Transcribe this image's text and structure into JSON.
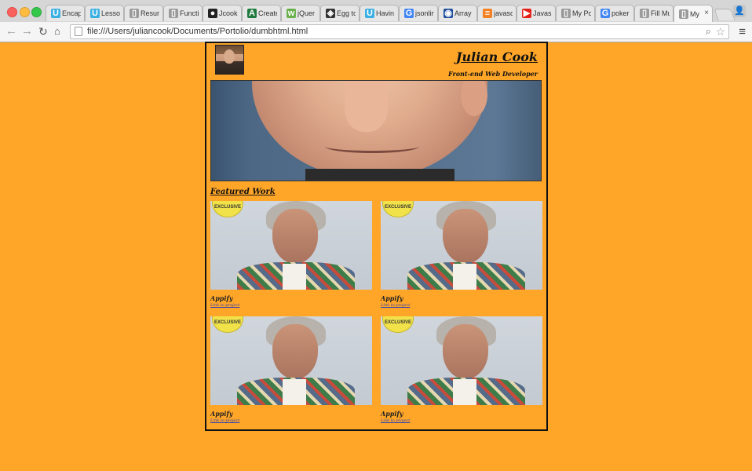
{
  "browser": {
    "tabs": [
      {
        "title": "Encap",
        "icon": "udacity-icon",
        "color": "#3ab0e2",
        "glyph": "U"
      },
      {
        "title": "Lessor",
        "icon": "udacity-icon",
        "color": "#3ab0e2",
        "glyph": "U"
      },
      {
        "title": "Resum",
        "icon": "page-icon",
        "color": "#9a9a9a",
        "glyph": "▯"
      },
      {
        "title": "Functi",
        "icon": "page-icon",
        "color": "#9a9a9a",
        "glyph": "▯"
      },
      {
        "title": "Jcook",
        "icon": "github-icon",
        "color": "#222222",
        "glyph": "●"
      },
      {
        "title": "Create",
        "icon": "codeacademy-icon",
        "color": "#1f7a3f",
        "glyph": "A"
      },
      {
        "title": "jQuer",
        "icon": "w3schools-icon",
        "color": "#6ab04c",
        "glyph": "w"
      },
      {
        "title": "Egg to",
        "icon": "codepen-icon",
        "color": "#333333",
        "glyph": "◈"
      },
      {
        "title": "Havin",
        "icon": "udacity-icon",
        "color": "#3ab0e2",
        "glyph": "U"
      },
      {
        "title": "jsonlin",
        "icon": "google-icon",
        "color": "#4285f4",
        "glyph": "G"
      },
      {
        "title": "Array",
        "icon": "mdn-icon",
        "color": "#1d4e9e",
        "glyph": "◉"
      },
      {
        "title": "javasc",
        "icon": "stackoverflow-icon",
        "color": "#f48024",
        "glyph": "≡"
      },
      {
        "title": "Javas",
        "icon": "youtube-icon",
        "color": "#e62117",
        "glyph": "▶"
      },
      {
        "title": "My Po",
        "icon": "page-icon",
        "color": "#9a9a9a",
        "glyph": "▯"
      },
      {
        "title": "poker",
        "icon": "google-icon",
        "color": "#4285f4",
        "glyph": "G"
      },
      {
        "title": "Fill Mu",
        "icon": "page-icon",
        "color": "#9a9a9a",
        "glyph": "▯"
      },
      {
        "title": "My",
        "icon": "page-icon",
        "color": "#9a9a9a",
        "glyph": "▯",
        "active": true
      }
    ],
    "url": "file:///Users/juliancook/Documents/Portolio/dumbhtml.html"
  },
  "page": {
    "background": "#ffa628",
    "name": "Julian Cook",
    "subtitle": "Front-end Web Developer",
    "section_title": "Featured Work",
    "sticker_text": "EXCLUSIVE",
    "projects": [
      {
        "title": "Appify",
        "link": "Link to project"
      },
      {
        "title": "Appify",
        "link": "Link to project"
      },
      {
        "title": "Appify",
        "link": "Link to project"
      },
      {
        "title": "Appify",
        "link": "Link to project"
      }
    ]
  }
}
